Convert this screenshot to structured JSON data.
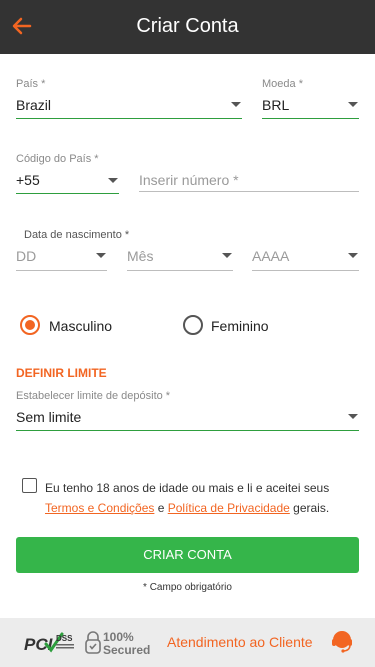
{
  "header": {
    "title": "Criar Conta"
  },
  "form": {
    "country": {
      "label": "País *",
      "value": "Brazil"
    },
    "currency": {
      "label": "Moeda *",
      "value": "BRL"
    },
    "country_code": {
      "label": "Código do País *",
      "value": "+55"
    },
    "phone": {
      "placeholder": "Inserir número *"
    },
    "birth": {
      "label": "Data de nascimento *",
      "day": "DD",
      "month": "Mês",
      "year": "AAAA"
    },
    "gender": {
      "male": "Masculino",
      "female": "Feminino",
      "selected": "Masculino"
    },
    "limit": {
      "section_title": "DEFINIR LIMITE",
      "label": "Estabelecer limite de depósito *",
      "value": "Sem limite"
    },
    "terms": {
      "text_before": "Eu tenho 18 anos de idade ou mais e li e aceitei seus ",
      "terms_link": "Termos e Condições",
      "and": " e ",
      "privacy_link": "Política de Privacidade",
      "text_after": " gerais.",
      "checked": false
    },
    "submit_label": "CRIAR CONTA",
    "required_note": "* Campo obrigatório"
  },
  "footer": {
    "pci_text": "PCI",
    "pci_dss": "DSS",
    "secured_pct": "100%",
    "secured_word": "Secured",
    "support_label": "Atendimento ao Cliente"
  },
  "colors": {
    "header_bg": "#333333",
    "accent": "#f26522",
    "button": "#35b54a",
    "active_underline": "#2e9e3e",
    "footer_bg": "#ececec"
  },
  "icons": [
    "arrow-left-icon",
    "chevron-down-icon",
    "pci-dss-logo",
    "secured-lock-icon",
    "headset-icon"
  ]
}
